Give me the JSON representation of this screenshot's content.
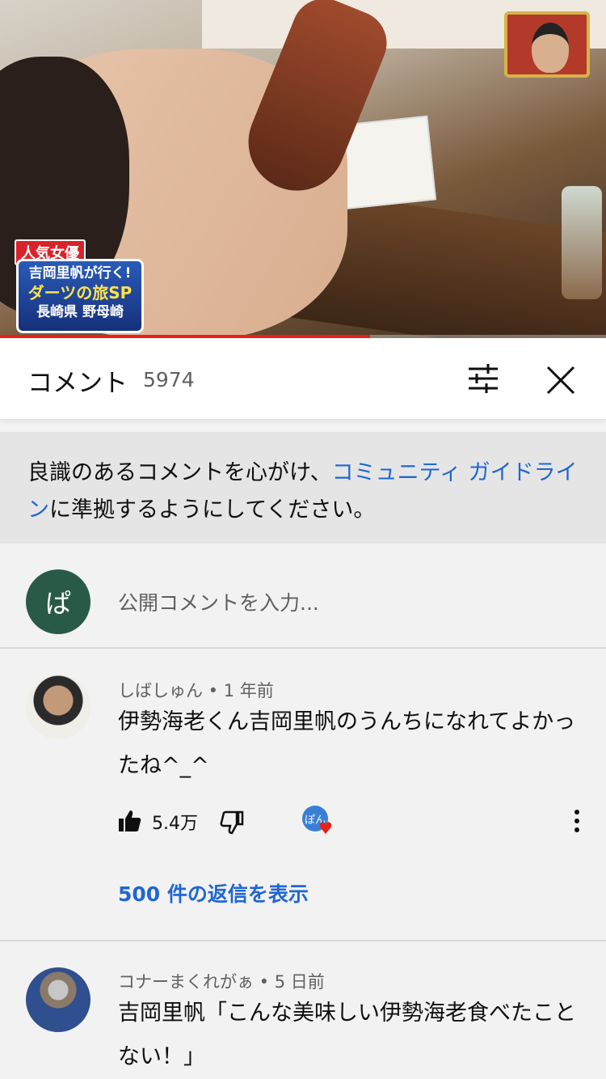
{
  "video": {
    "caption_tag": "人気女優",
    "caption_line1": "吉岡里帆が行く!",
    "caption_line2": "ダーツの旅SP",
    "caption_line3": "長崎県 野母崎",
    "progress_fraction": 0.61
  },
  "comments_header": {
    "title": "コメント",
    "count": "5974",
    "filter_icon": "sort-filter-icon",
    "close_icon": "close-icon"
  },
  "guideline": {
    "text_before": "良識のあるコメントを心がけ、",
    "link_text": "コミュニティ ガイドライン",
    "text_after": "に準拠するようにしてください。"
  },
  "composer": {
    "avatar_letter": "ぱ",
    "placeholder": "公開コメントを入力..."
  },
  "comments": [
    {
      "author": "しばしゅん",
      "age": "1 年前",
      "text": "伊勢海老くん吉岡里帆のうんちになれてよかったね^_^",
      "likes": "5.4万",
      "creator_avatar_text": "ぽん",
      "replies_label": "500 件の返信を表示"
    },
    {
      "author": "コナーまくれがぁ",
      "age": "5 日前",
      "text": "吉岡里帆「こんな美味しい伊勢海老食べたことない！」"
    }
  ],
  "colors": {
    "link_blue": "#1f66d3",
    "progress_red": "#e62117",
    "composer_avatar_bg": "#295a47"
  }
}
